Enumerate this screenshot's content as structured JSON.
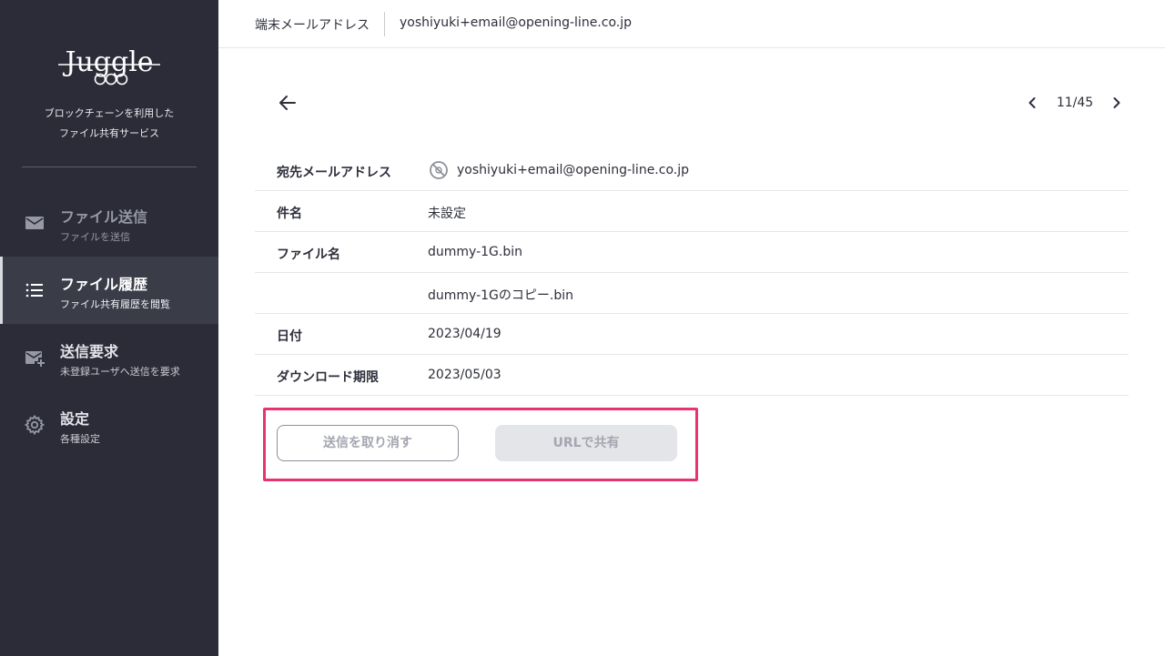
{
  "sidebar": {
    "logo": "Juggle",
    "tagline_line1": "ブロックチェーンを利用した",
    "tagline_line2": "ファイル共有サービス",
    "items": [
      {
        "title": "ファイル送信",
        "sub": "ファイルを送信",
        "icon": "mail-icon"
      },
      {
        "title": "ファイル履歴",
        "sub": "ファイル共有履歴を閲覧",
        "icon": "list-icon"
      },
      {
        "title": "送信要求",
        "sub": "未登録ユーザへ送信を要求",
        "icon": "mail-plus-icon"
      },
      {
        "title": "設定",
        "sub": "各種設定",
        "icon": "gear-icon"
      }
    ]
  },
  "header": {
    "label": "端末メールアドレス",
    "email": "yoshiyuki+email@opening-line.co.jp"
  },
  "pager": {
    "text": "11/45"
  },
  "details": {
    "rows": [
      {
        "label": "宛先メールアドレス",
        "value": "yoshiyuki+email@opening-line.co.jp"
      },
      {
        "label": "件名",
        "value": "未設定"
      },
      {
        "label": "ファイル名",
        "value": "dummy-1G.bin"
      },
      {
        "label": "",
        "value": "dummy-1Gのコピー.bin"
      },
      {
        "label": "日付",
        "value": "2023/04/19"
      },
      {
        "label": "ダウンロード期限",
        "value": "2023/05/03"
      }
    ]
  },
  "actions": {
    "cancel_label": "送信を取り消す",
    "share_label": "URLで共有"
  },
  "colors": {
    "sidebar_bg": "#2b2c37",
    "highlight": "#e8336f"
  }
}
